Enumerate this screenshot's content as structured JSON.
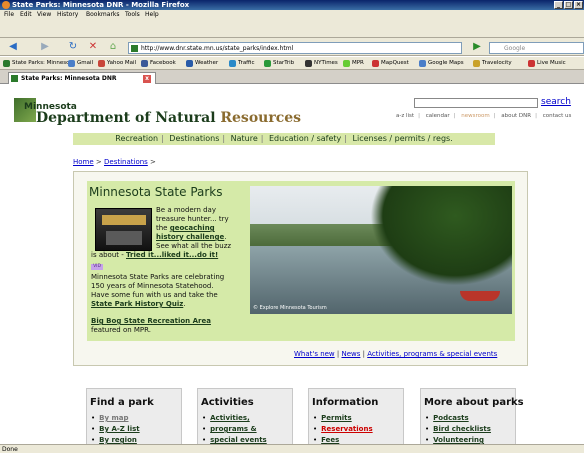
{
  "window": {
    "title": "State Parks: Minnesota DNR - Mozilla Firefox",
    "min": "_",
    "max": "□",
    "close": "×"
  },
  "menu": [
    "File",
    "Edit",
    "View",
    "History",
    "Bookmarks",
    "Tools",
    "Help"
  ],
  "nav": {
    "url": "http://www.dnr.state.mn.us/state_parks/index.html",
    "search_placeholder": "Google",
    "back": "◀",
    "forward": "▶",
    "reload": "↻",
    "stop": "✕",
    "home": "⌂",
    "go": "▶"
  },
  "bookmarks": [
    "State Parks: Minneso...",
    "Gmail",
    "Yahoo Mail",
    "Facebook",
    "Weather",
    "Traffic",
    "StarTrib",
    "NYTimes",
    "MPR",
    "MapQuest",
    "Google Maps",
    "Travelocity",
    "Live Music"
  ],
  "tab": {
    "label": "State Parks: Minnesota DNR",
    "close": "x"
  },
  "site": {
    "logo_top": "Minnesota",
    "logo_main_a": "Department of ",
    "logo_main_b": "Natural",
    "logo_main_c": " Resources",
    "search_label": "search",
    "toplinks": [
      "a-z list",
      "calendar",
      "newsroom",
      "about DNR",
      "contact us"
    ],
    "mainnav": [
      "Recreation",
      "Destinations",
      "Nature",
      "Education / safety",
      "Licenses / permits / regs."
    ]
  },
  "breadcrumb": {
    "home": "Home",
    "sep": " > ",
    "destinations": "Destinations",
    "tail": " >"
  },
  "feature": {
    "title": "Minnesota State Parks",
    "l1": "Be a modern day",
    "l2": "treasure hunter... try",
    "l3": "the ",
    "geo_link1": "geocaching",
    "geo_link2": "history challenge",
    "l4_end": ".",
    "l5": "See what all the buzz",
    "l6a": "is about - ",
    "tried_link": "Tried it...liked it...do it!",
    "vid_badge": "VID",
    "p2_1": "Minnesota State Parks are celebrating",
    "p2_2": "150 years of Minnesota Statehood.",
    "p2_3": "Have some fun with us and take the",
    "quiz_link": "State Park History Quiz",
    "quiz_end": ".",
    "bigbog_link": "Big Bog State Recreation Area",
    "bigbog_tail": "featured on MPR.",
    "photo_credit": "© Explore Minnesota Tourism"
  },
  "newslinks": {
    "a": "What's new",
    "b": "News",
    "c": "Activities, programs & special events",
    "sep": " | "
  },
  "boxes": [
    {
      "title": "Find a park",
      "items": [
        {
          "t": "By map",
          "s": "gray"
        },
        {
          "t": "By A-Z list",
          "s": ""
        },
        {
          "t": "By region",
          "s": ""
        }
      ]
    },
    {
      "title": "Activities",
      "items": [
        {
          "t": "Activities,",
          "s": ""
        },
        {
          "t": "programs &",
          "s": ""
        },
        {
          "t": "special events",
          "s": ""
        }
      ]
    },
    {
      "title": "Information",
      "items": [
        {
          "t": "Permits",
          "s": ""
        },
        {
          "t": "Reservations",
          "s": "red"
        },
        {
          "t": "Fees",
          "s": ""
        }
      ]
    },
    {
      "title": "More about parks",
      "items": [
        {
          "t": "Podcasts",
          "s": ""
        },
        {
          "t": "Bird checklists",
          "s": ""
        },
        {
          "t": "Volunteering",
          "s": ""
        }
      ]
    }
  ],
  "status": "Done"
}
